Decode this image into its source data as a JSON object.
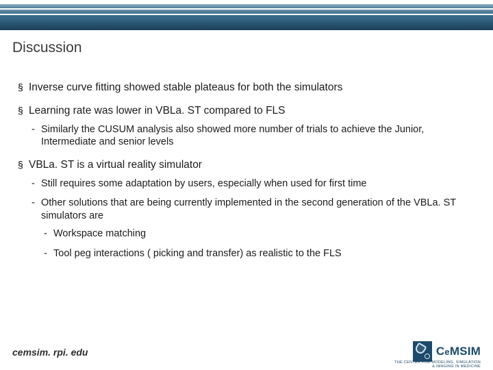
{
  "title": "Discussion",
  "bullets": [
    {
      "text": "Inverse curve fitting showed stable plateaus for both the simulators",
      "sub": []
    },
    {
      "text": "Learning rate was lower in VBLa. ST compared to FLS",
      "sub": [
        {
          "text": "Similarly the  CUSUM analysis also showed more number of trials to achieve the Junior, Intermediate and senior levels",
          "sub": []
        }
      ]
    },
    {
      "text": "VBLa. ST is a virtual reality simulator",
      "sub": [
        {
          "text": "Still requires some adaptation by users, especially when used for first time",
          "sub": []
        },
        {
          "text": "Other solutions that are being currently implemented in the second generation of the VBLa. ST simulators are",
          "sub": [
            {
              "text": "Workspace matching"
            },
            {
              "text": "Tool peg interactions ( picking and transfer) as realistic to the FLS"
            }
          ]
        }
      ]
    }
  ],
  "footer": "cemsim. rpi. edu",
  "logo": {
    "name": "CeMSIM",
    "tagline1": "THE CENTER FOR MODELING, SIMULATION",
    "tagline2": "& IMAGING IN MEDICINE"
  }
}
